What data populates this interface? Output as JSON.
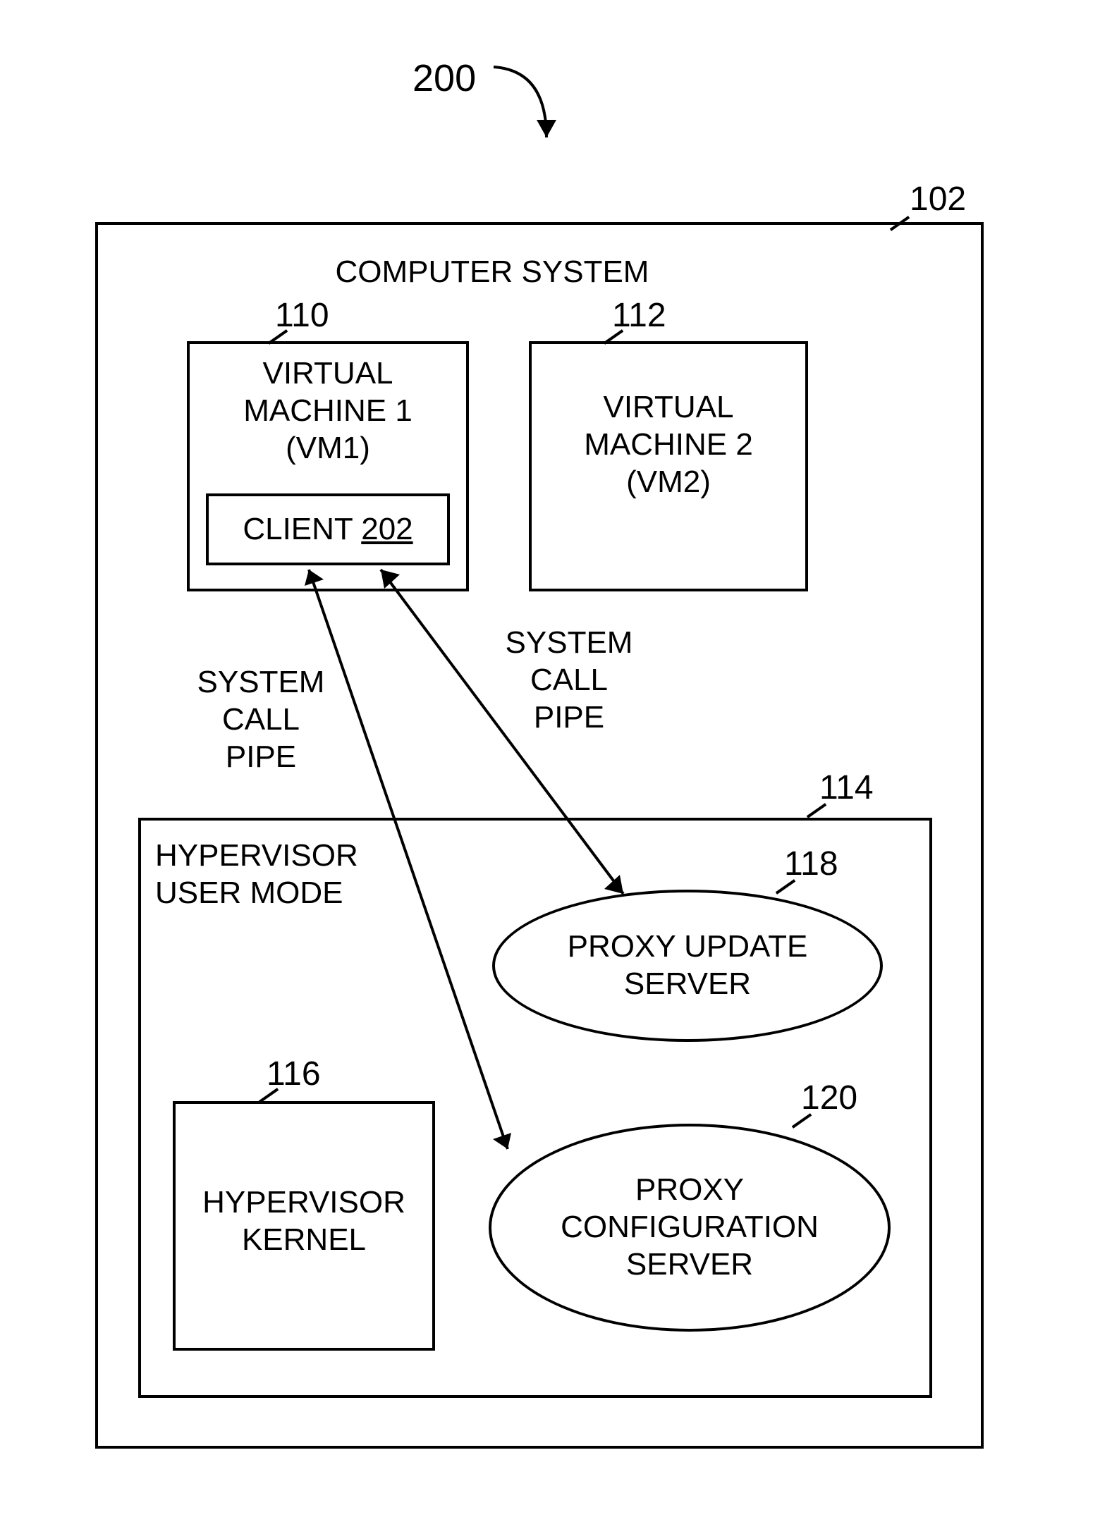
{
  "refs": {
    "figure": "200",
    "computer_system": "102",
    "vm1": "110",
    "vm2": "112",
    "client_num": "202",
    "hypervisor_user_mode": "114",
    "hypervisor_kernel": "116",
    "proxy_update": "118",
    "proxy_config": "120"
  },
  "labels": {
    "computer_system": "COMPUTER SYSTEM",
    "vm1_line1": "VIRTUAL",
    "vm1_line2": "MACHINE 1",
    "vm1_line3": "(VM1)",
    "vm2_line1": "VIRTUAL",
    "vm2_line2": "MACHINE 2",
    "vm2_line3": "(VM2)",
    "client_prefix": "CLIENT ",
    "hyp_user_line1": "HYPERVISOR",
    "hyp_user_line2": "USER MODE",
    "hyp_kernel_line1": "HYPERVISOR",
    "hyp_kernel_line2": "KERNEL",
    "proxy_update_line1": "PROXY UPDATE",
    "proxy_update_line2": "SERVER",
    "proxy_config_line1": "PROXY",
    "proxy_config_line2": "CONFIGURATION",
    "proxy_config_line3": "SERVER",
    "arrow1_line1": "SYSTEM",
    "arrow1_line2": "CALL",
    "arrow1_line3": "PIPE",
    "arrow2_line1": "SYSTEM",
    "arrow2_line2": "CALL",
    "arrow2_line3": "PIPE"
  }
}
